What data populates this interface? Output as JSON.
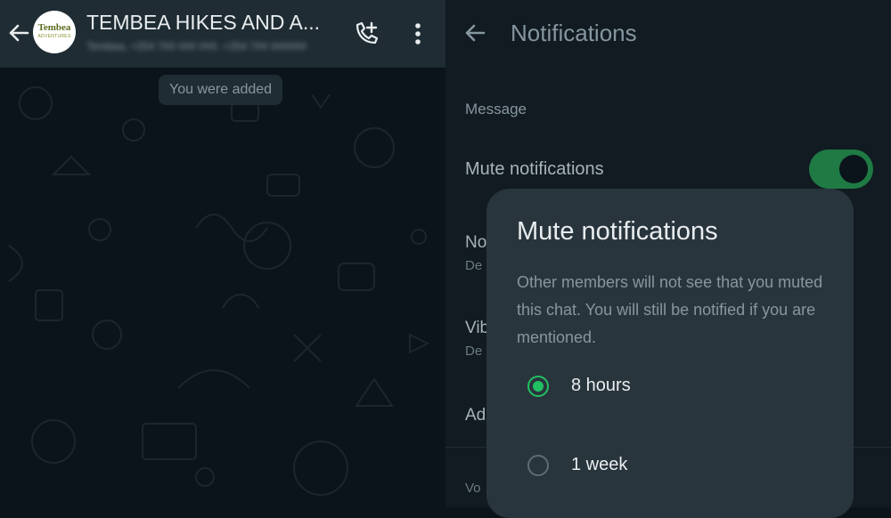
{
  "chat": {
    "title": "TEMBEA HIKES AND A...",
    "subtitle": "Tembea, +254 7## ### ###, +254 7## ######",
    "avatar_logo_line1": "Tembea",
    "avatar_logo_line2": "ADVENTURES",
    "system_message": "You were added",
    "icons": {
      "back": "arrow-left-icon",
      "add_call": "add-call-icon",
      "menu": "more-vertical-icon"
    }
  },
  "settings": {
    "title": "Notifications",
    "section_label": "Message",
    "mute_label": "Mute notifications",
    "mute_enabled": true,
    "background_rows": [
      {
        "title": "No",
        "subtitle": "De"
      },
      {
        "title": "Vib",
        "subtitle": "De"
      },
      {
        "title": "Ad",
        "subtitle": ""
      },
      {
        "title": "Vo",
        "subtitle": ""
      }
    ]
  },
  "dialog": {
    "title": "Mute notifications",
    "body": "Other members will not see that you muted this chat. You will still be notified if you are mentioned.",
    "options": [
      {
        "label": "8 hours",
        "selected": true
      },
      {
        "label": "1 week",
        "selected": false
      }
    ]
  },
  "colors": {
    "accent_green": "#21c063",
    "toggle_track": "#1f7a44",
    "header_bg": "#1f2c34",
    "dialog_bg": "#29353d",
    "page_bg": "#111b21"
  }
}
